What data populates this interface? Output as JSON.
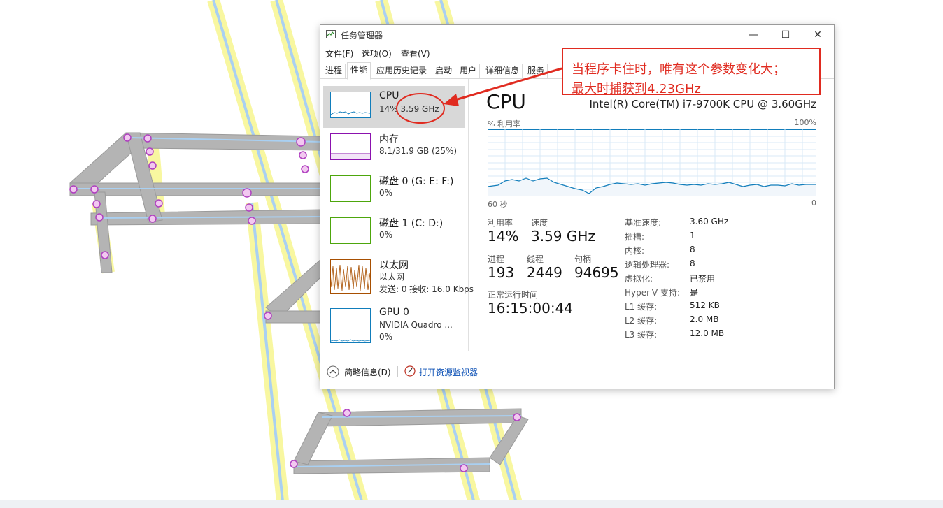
{
  "window": {
    "title": "任务管理器",
    "controls": {
      "minimize": "—",
      "maximize": "☐",
      "close": "✕"
    }
  },
  "menu": [
    "文件(F)",
    "选项(O)",
    "查看(V)"
  ],
  "tabs": [
    "进程",
    "性能",
    "应用历史记录",
    "启动",
    "用户",
    "详细信息",
    "服务"
  ],
  "active_tab": "性能",
  "resources": [
    {
      "name": "CPU",
      "detail": "14%",
      "detail_extra": "3.59 GHz"
    },
    {
      "name": "内存",
      "detail": "8.1/31.9 GB (25%)"
    },
    {
      "name": "磁盘 0 (G: E: F:)",
      "detail": "0%"
    },
    {
      "name": "磁盘 1 (C: D:)",
      "detail": "0%"
    },
    {
      "name": "以太网",
      "detail": "以太网",
      "detail2": "发送: 0 接收: 16.0 Kbps"
    },
    {
      "name": "GPU 0",
      "detail": "NVIDIA Quadro ...",
      "detail2": "0%"
    }
  ],
  "cpu_detail": {
    "title": "CPU",
    "model": "Intel(R) Core(TM) i7-9700K CPU @ 3.60GHz",
    "graph_label": "% 利用率",
    "graph_max": "100%",
    "graph_time": "60 秒",
    "graph_min": "0",
    "utilization_label": "利用率",
    "utilization": "14%",
    "speed_label": "速度",
    "speed": "3.59 GHz",
    "processes_label": "进程",
    "processes": "193",
    "threads_label": "线程",
    "threads": "2449",
    "handles_label": "句柄",
    "handles": "94695",
    "uptime_label": "正常运行时间",
    "uptime": "16:15:00:44",
    "properties": [
      {
        "label": "基准速度:",
        "value": "3.60 GHz"
      },
      {
        "label": "插槽:",
        "value": "1"
      },
      {
        "label": "内核:",
        "value": "8"
      },
      {
        "label": "逻辑处理器:",
        "value": "8"
      },
      {
        "label": "虚拟化:",
        "value": "已禁用"
      },
      {
        "label": "Hyper-V 支持:",
        "value": "是"
      },
      {
        "label": "L1 缓存:",
        "value": "512 KB"
      },
      {
        "label": "L2 缓存:",
        "value": "2.0 MB"
      },
      {
        "label": "L3 缓存:",
        "value": "12.0 MB"
      }
    ]
  },
  "footer": {
    "fewer_details": "简略信息(D)",
    "open_monitor": "打开资源监视器"
  },
  "annotation": {
    "line1": "当程序卡住时，唯有这个参数变化大；",
    "line2": "最大时捕获到4.23GHz"
  },
  "colors": {
    "annotation_red": "#e02b20",
    "cpu_graph": "#117dbb",
    "memory_graph": "#8b12ae",
    "disk_graph": "#4da60c",
    "ethernet_graph": "#a74f01",
    "link_blue": "#0a4fb5"
  }
}
